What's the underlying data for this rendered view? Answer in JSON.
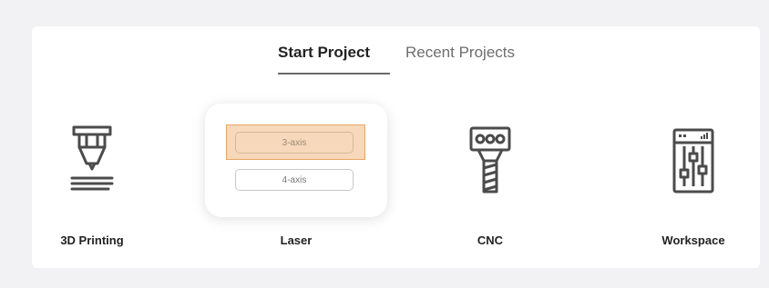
{
  "tabs": {
    "start": "Start Project",
    "recent": "Recent Projects"
  },
  "items": {
    "printing": {
      "label": "3D Printing",
      "icon": "3d-printer-nozzle-icon"
    },
    "laser": {
      "label": "Laser",
      "options": [
        "3-axis",
        "4-axis"
      ],
      "selected": "3-axis"
    },
    "cnc": {
      "label": "CNC",
      "icon": "cnc-spindle-icon"
    },
    "workspace": {
      "label": "Workspace",
      "icon": "workspace-controls-icon"
    }
  },
  "colors": {
    "highlight_fill": "#f7d8ba",
    "highlight_border": "#e8a663"
  }
}
